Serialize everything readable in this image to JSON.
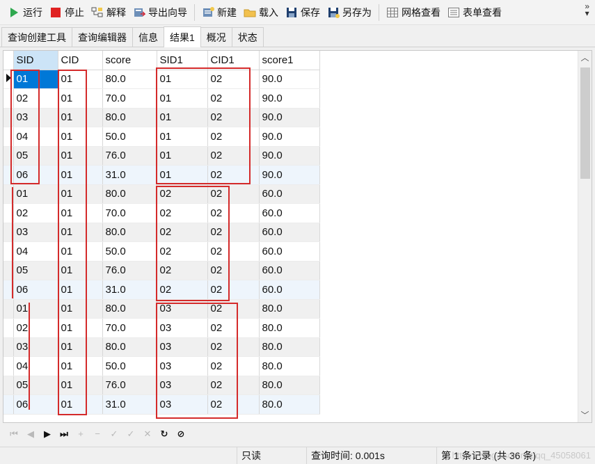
{
  "toolbar": {
    "run": "运行",
    "stop": "停止",
    "explain": "解释",
    "export_wizard": "导出向导",
    "new": "新建",
    "load": "载入",
    "save": "保存",
    "save_as": "另存为",
    "grid_view": "网格查看",
    "form_view": "表单查看",
    "overflow": "»"
  },
  "tabs": [
    {
      "label": "查询创建工具"
    },
    {
      "label": "查询编辑器"
    },
    {
      "label": "信息"
    },
    {
      "label": "结果1",
      "active": true
    },
    {
      "label": "概况"
    },
    {
      "label": "状态"
    }
  ],
  "grid": {
    "columns": [
      "SID",
      "CID",
      "score",
      "SID1",
      "CID1",
      "score1"
    ],
    "rows": [
      [
        "01",
        "01",
        "80.0",
        "01",
        "02",
        "90.0"
      ],
      [
        "02",
        "01",
        "70.0",
        "01",
        "02",
        "90.0"
      ],
      [
        "03",
        "01",
        "80.0",
        "01",
        "02",
        "90.0"
      ],
      [
        "04",
        "01",
        "50.0",
        "01",
        "02",
        "90.0"
      ],
      [
        "05",
        "01",
        "76.0",
        "01",
        "02",
        "90.0"
      ],
      [
        "06",
        "01",
        "31.0",
        "01",
        "02",
        "90.0"
      ],
      [
        "01",
        "01",
        "80.0",
        "02",
        "02",
        "60.0"
      ],
      [
        "02",
        "01",
        "70.0",
        "02",
        "02",
        "60.0"
      ],
      [
        "03",
        "01",
        "80.0",
        "02",
        "02",
        "60.0"
      ],
      [
        "04",
        "01",
        "50.0",
        "02",
        "02",
        "60.0"
      ],
      [
        "05",
        "01",
        "76.0",
        "02",
        "02",
        "60.0"
      ],
      [
        "06",
        "01",
        "31.0",
        "02",
        "02",
        "60.0"
      ],
      [
        "01",
        "01",
        "80.0",
        "03",
        "02",
        "80.0"
      ],
      [
        "02",
        "01",
        "70.0",
        "03",
        "02",
        "80.0"
      ],
      [
        "03",
        "01",
        "80.0",
        "03",
        "02",
        "80.0"
      ],
      [
        "04",
        "01",
        "50.0",
        "03",
        "02",
        "80.0"
      ],
      [
        "05",
        "01",
        "76.0",
        "03",
        "02",
        "80.0"
      ],
      [
        "06",
        "01",
        "31.0",
        "03",
        "02",
        "80.0"
      ]
    ]
  },
  "navbar": {
    "first": "⏮",
    "prev": "◀",
    "next": "▶",
    "last": "⏭",
    "add": "+",
    "delete": "−",
    "apply": "✓",
    "cancel": "✓",
    "clear": "✕",
    "refresh": "↻",
    "stop": "⊘"
  },
  "statusbar": {
    "mode": "只读",
    "query_time": "查询时间: 0.001s",
    "record": "第 1 条记录 (共 36 条)",
    "watermark": "https://blog.csdn.net/qq_45058061"
  },
  "colors": {
    "annotation": "#d42a2a",
    "selection": "#0078d7"
  }
}
